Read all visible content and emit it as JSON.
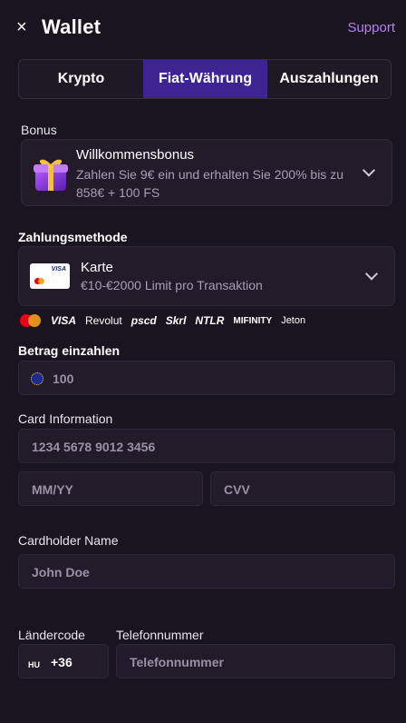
{
  "header": {
    "close_icon": "×",
    "title": "Wallet",
    "support_label": "Support"
  },
  "tabs": [
    {
      "label": "Krypto",
      "active": false
    },
    {
      "label": "Fiat-Währung",
      "active": true
    },
    {
      "label": "Auszahlungen",
      "active": false
    }
  ],
  "bonus": {
    "section_label": "Bonus",
    "title": "Willkommensbonus",
    "description": "Zahlen Sie 9€ ein und erhalten Sie 200% bis zu 858€ + 100 FS"
  },
  "payment_method": {
    "section_label": "Zahlungsmethode",
    "title": "Karte",
    "limits": "€10-€2000 Limit pro Transaktion",
    "card_brand": "VISA"
  },
  "provider_logos": [
    "VISA",
    "Revolut",
    "pscd",
    "Skrl",
    "NTLR",
    "MIFINITY",
    "Jeton"
  ],
  "amount": {
    "label": "Betrag einzahlen",
    "value": "100"
  },
  "card_info": {
    "label": "Card Information",
    "number_placeholder": "1234 5678 9012 3456",
    "expiry_placeholder": "MM/YY",
    "cvv_placeholder": "CVV"
  },
  "cardholder": {
    "label": "Cardholder Name",
    "placeholder": "John Doe"
  },
  "phone": {
    "country_label": "Ländercode",
    "country_flag": "HU",
    "country_code": "+36",
    "number_label": "Telefonnummer",
    "number_placeholder": "Telefonnummer"
  },
  "colors": {
    "background": "#1a1420",
    "accent_tab": "#3e2393",
    "support_link": "#b97ef0"
  }
}
